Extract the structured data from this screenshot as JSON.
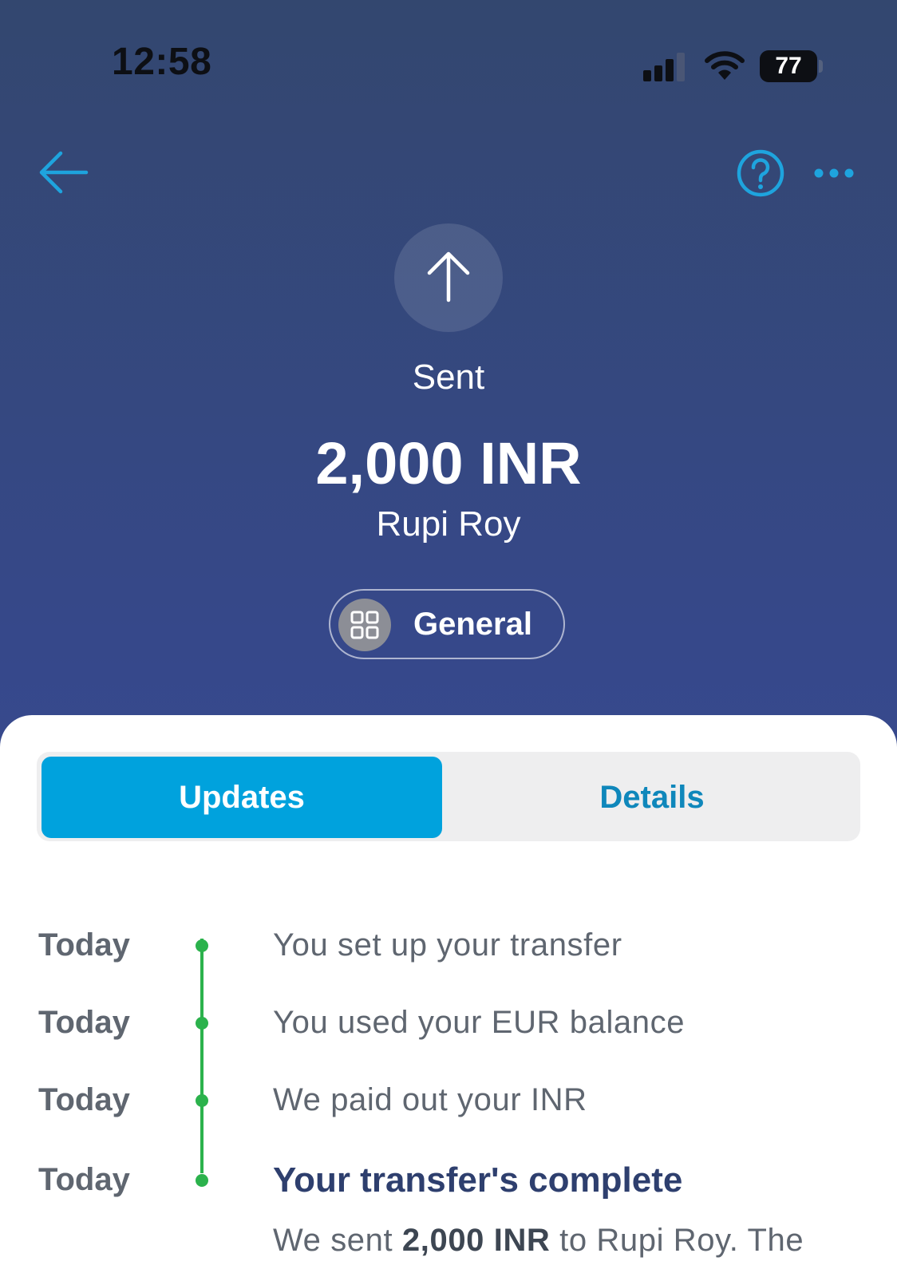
{
  "status_bar": {
    "time": "12:58",
    "battery": "77"
  },
  "nav": {
    "back_icon": "arrow-left-icon",
    "help_icon": "question-circle-icon",
    "more_icon": "more-horizontal-icon"
  },
  "transaction": {
    "direction_icon": "arrow-up-icon",
    "status": "Sent",
    "amount": "2,000 INR",
    "recipient": "Rupi Roy",
    "category": "General",
    "category_icon": "grid-icon"
  },
  "tabs": [
    {
      "label": "Updates",
      "active": true
    },
    {
      "label": "Details",
      "active": false
    }
  ],
  "timeline": [
    {
      "date": "Today",
      "text": "You set up your transfer"
    },
    {
      "date": "Today",
      "text": "You used your EUR balance"
    },
    {
      "date": "Today",
      "text": "We paid out your INR"
    },
    {
      "date": "Today",
      "text": "Your transfer's complete"
    }
  ],
  "summary": {
    "prefix": "We sent ",
    "amount": "2,000 INR",
    "suffix": " to Rupi Roy. The"
  },
  "colors": {
    "accent": "#00a2dd",
    "timeline_green": "#2bb24c",
    "header_gradient_top": "#33476f",
    "header_gradient_bottom": "#3c4f9c"
  }
}
